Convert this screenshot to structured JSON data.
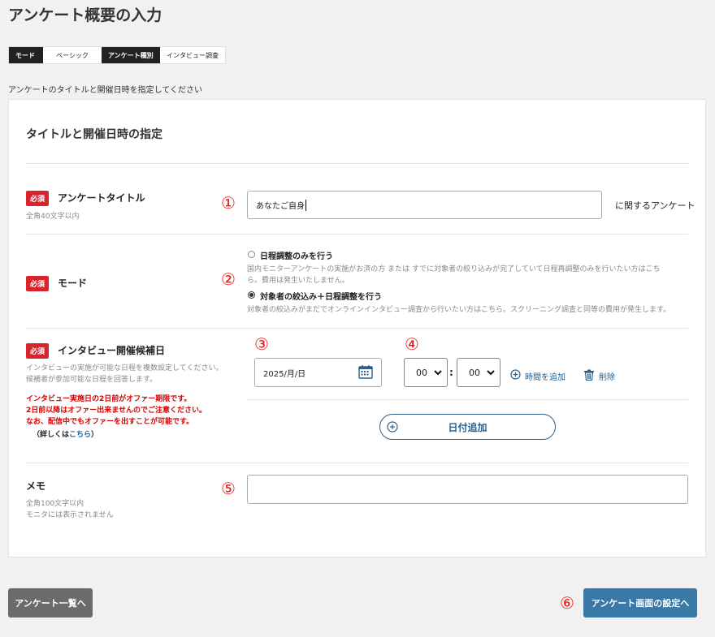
{
  "page": {
    "title": "アンケート概要の入力",
    "instruction": "アンケートのタイトルと開催日時を指定してください"
  },
  "tags": [
    {
      "label": "モード"
    },
    {
      "label": "ベーシック"
    },
    {
      "label": "アンケート種別"
    },
    {
      "label": "インタビュー調査"
    }
  ],
  "card": {
    "title": "タイトルと開催日時の指定"
  },
  "required_label": "必須",
  "markers": [
    "①",
    "②",
    "③",
    "④",
    "⑤",
    "⑥"
  ],
  "survey_title": {
    "label": "アンケートタイトル",
    "hint": "全角40文字以内",
    "value": "あなたご自身",
    "suffix": "に関するアンケート"
  },
  "mode": {
    "label": "モード",
    "option1": {
      "label": "日程調整のみを行う",
      "desc1": "国内モニターアンケートの実施がお済の方 または すでに対象者の絞り込みが完了していて日程再調整のみを行いたい方はこち",
      "desc2": "ら。費用は発生いたしません。"
    },
    "option2": {
      "label": "対象者の絞込み＋日程調整を行う",
      "desc": "対象者の絞込みがまだでオンラインインタビュー調査から行いたい方はこちら。スクリーニング調査と同等の費用が発生します。"
    }
  },
  "interview": {
    "label": "インタビュー開催候補日",
    "hint1": "インタビューの実施が可能な日程を複数設定してください。",
    "hint2": "候補者が参加可能な日程を回答します。",
    "warn1": "インタビュー実施日の2日前がオファー期限です。",
    "warn2": "2日前以降はオファー出来ませんのでご注意ください。",
    "warn3": "なお、配信中でもオファーを出すことが可能です。",
    "more_prefix": "（詳しくは",
    "more_link": "こちら",
    "more_suffix": "）",
    "date_value": "2025/月/日",
    "hour": "00",
    "minute": "00",
    "time_sep": ":",
    "add_time": "時間を追加",
    "delete": "削除",
    "add_date": "日付追加"
  },
  "memo": {
    "label": "メモ",
    "hint1": "全角100文字以内",
    "hint2": "モニタには表示されません",
    "value": ""
  },
  "footer": {
    "back_button": "アンケート一覧へ",
    "next_button": "アンケート画面の設定へ"
  },
  "colors": {
    "required": "#d9232d",
    "primary": "#3a78a8",
    "secondary": "#6b6b6b",
    "marker": "#e11111"
  }
}
